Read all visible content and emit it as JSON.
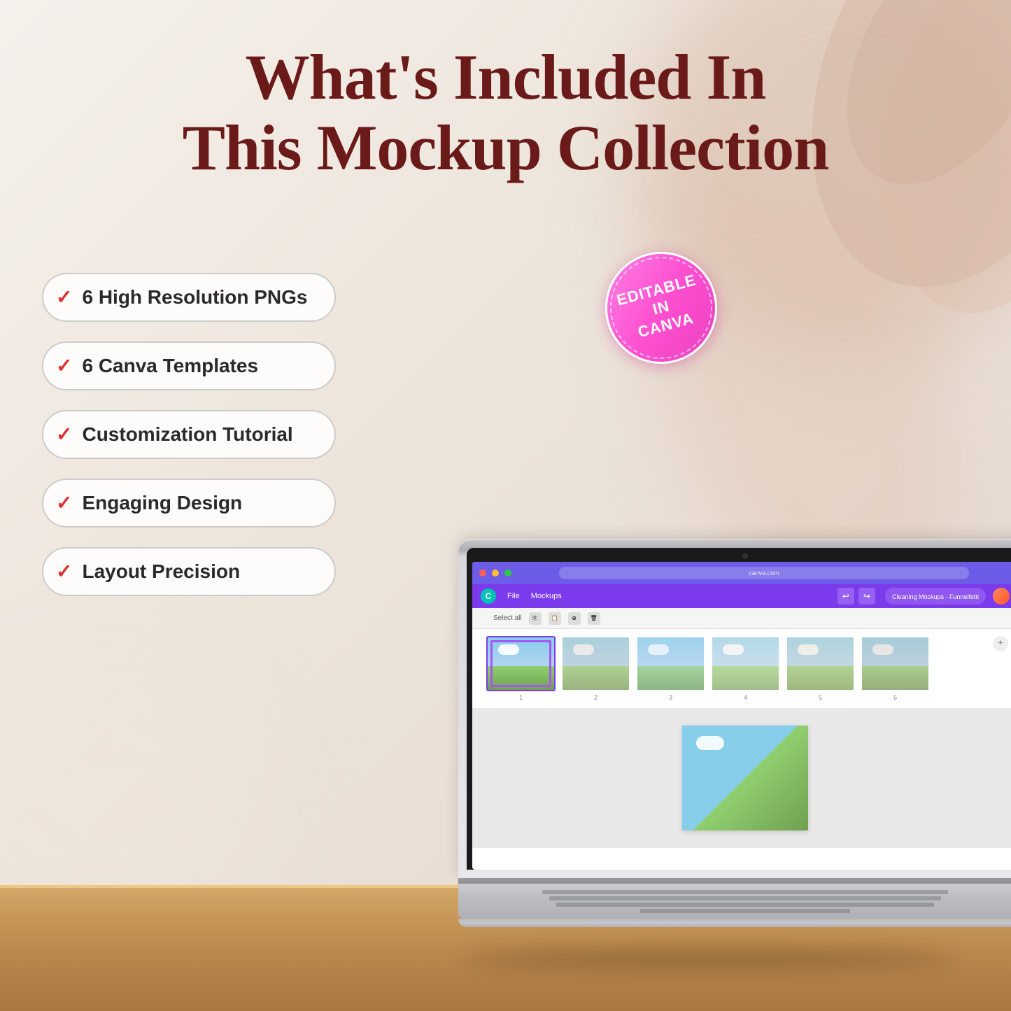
{
  "page": {
    "title": "What's Included In This Mockup Collection",
    "title_line1": "What's Included In",
    "title_line2": "This Mockup Collection"
  },
  "features": [
    {
      "id": 1,
      "label": "6 High Resolution PNGs",
      "check": "✓"
    },
    {
      "id": 2,
      "label": "6 Canva Templates",
      "check": "✓"
    },
    {
      "id": 3,
      "label": "Customization Tutorial",
      "check": "✓"
    },
    {
      "id": 4,
      "label": "Engaging Design",
      "check": "✓"
    },
    {
      "id": 5,
      "label": "Layout Precision",
      "check": "✓"
    }
  ],
  "badge": {
    "line1": "EDITABLE",
    "line2": "IN",
    "line3": "CANVA"
  },
  "canva": {
    "url": "canva.com",
    "title": "Cleaning Mockups - Funnelfetti",
    "select_all": "Select all",
    "thumbnails": [
      {
        "num": "1",
        "selected": true
      },
      {
        "num": "2",
        "selected": false
      },
      {
        "num": "3",
        "selected": false
      },
      {
        "num": "4",
        "selected": false
      },
      {
        "num": "5",
        "selected": false
      },
      {
        "num": "6",
        "selected": false
      }
    ],
    "nav_items": [
      "File",
      "Mockups"
    ]
  },
  "colors": {
    "title": "#6b1a1a",
    "check": "#e03030",
    "badge_bg": "#ff50d0",
    "canva_purple": "#7c3aed",
    "table_wood": "#d4a96a"
  }
}
